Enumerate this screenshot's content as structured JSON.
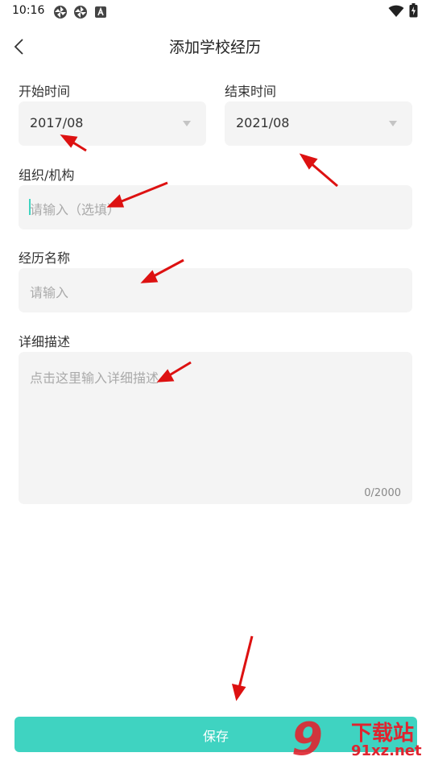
{
  "status_bar": {
    "time": "10:16",
    "icons": [
      "pinwheel-icon",
      "pinwheel-icon",
      "app-a-icon",
      "wifi-icon",
      "battery-charging-icon"
    ]
  },
  "nav": {
    "title": "添加学校经历",
    "back_icon": "chevron-left-icon"
  },
  "form": {
    "start_time": {
      "label": "开始时间",
      "value": "2017/08"
    },
    "end_time": {
      "label": "结束时间",
      "value": "2021/08"
    },
    "organization": {
      "label": "组织/机构",
      "placeholder": "请输入（选填）"
    },
    "experience_name": {
      "label": "经历名称",
      "placeholder": "请输入"
    },
    "description": {
      "label": "详细描述",
      "placeholder": "点击这里输入详细描述",
      "counter": "0/2000"
    }
  },
  "save_button": {
    "label": "保存"
  },
  "watermark": {
    "line1": "下载站",
    "line2": "91xz.net",
    "logo": "9"
  },
  "colors": {
    "accent": "#3fd3c1",
    "annotation_arrow": "#dd1111",
    "field_bg": "#f4f4f4",
    "watermark": "#e0242f"
  }
}
